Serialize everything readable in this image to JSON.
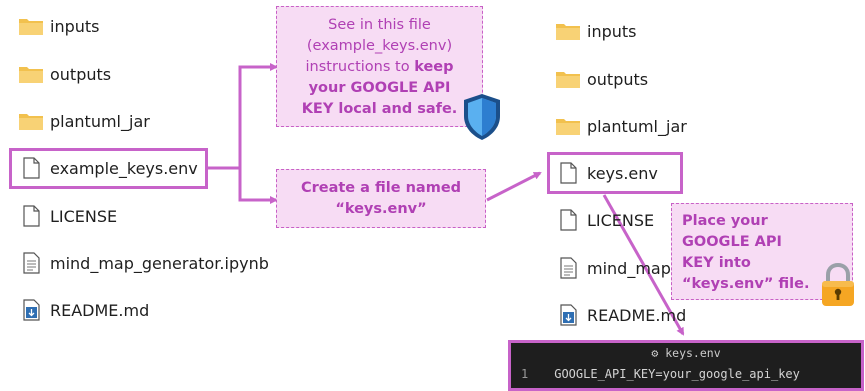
{
  "left_files": [
    {
      "name": "inputs",
      "icon": "folder-icon"
    },
    {
      "name": "outputs",
      "icon": "folder-icon"
    },
    {
      "name": "plantuml_jar",
      "icon": "folder-icon"
    },
    {
      "name": "example_keys.env",
      "icon": "file-icon"
    },
    {
      "name": "LICENSE",
      "icon": "file-icon"
    },
    {
      "name": "mind_map_generator.ipynb",
      "icon": "notebook-file-icon"
    },
    {
      "name": "README.md",
      "icon": "markdown-file-icon"
    }
  ],
  "right_files": [
    {
      "name": "inputs",
      "icon": "folder-icon"
    },
    {
      "name": "outputs",
      "icon": "folder-icon"
    },
    {
      "name": "plantuml_jar",
      "icon": "folder-icon"
    },
    {
      "name": "keys.env",
      "icon": "file-icon"
    },
    {
      "name": "LICENSE",
      "icon": "file-icon"
    },
    {
      "name": "mind_map",
      "icon": "notebook-file-icon"
    },
    {
      "name": "README.md",
      "icon": "markdown-file-icon"
    }
  ],
  "callouts": {
    "instructions": {
      "line1": "See in this file",
      "line2": "(example_keys.env)",
      "line3_plain": "instructions to ",
      "line3_bold": "keep",
      "line4_bold": "your GOOGLE API",
      "line5_bold": "KEY local and safe."
    },
    "create": {
      "line1": "Create a file named",
      "line2": "“keys.env”"
    },
    "place": {
      "line1": "Place your",
      "line2": "GOOGLE API",
      "line3": "KEY into",
      "line4": "“keys.env” file."
    }
  },
  "terminal": {
    "title": "keys.env",
    "line_number": "1",
    "code": "GOOGLE_API_KEY=your_google_api_key"
  },
  "colors": {
    "accent": "#c763c9",
    "callout_fill": "#f7dcf4",
    "callout_text": "#b040b4",
    "folder": "#f2c14e",
    "terminal_bg": "#1e1e1e"
  }
}
